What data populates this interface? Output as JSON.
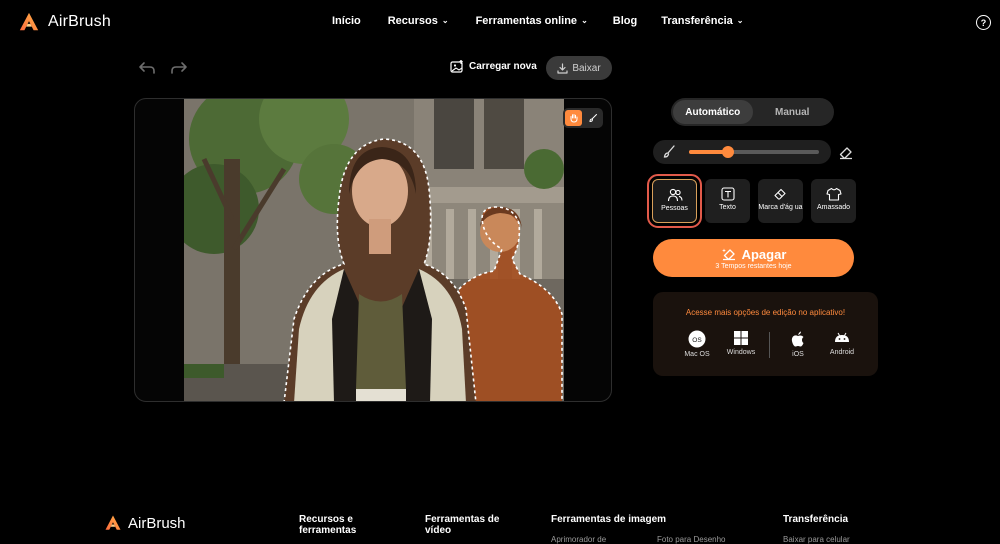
{
  "app": {
    "name": "AirBrush"
  },
  "nav": {
    "items": [
      {
        "label": "Início",
        "dropdown": false
      },
      {
        "label": "Recursos",
        "dropdown": true
      },
      {
        "label": "Ferramentas online",
        "dropdown": true
      },
      {
        "label": "Blog",
        "dropdown": false
      },
      {
        "label": "Transferência",
        "dropdown": true
      }
    ],
    "help_icon": "?"
  },
  "toolbar": {
    "upload_label": "Carregar nova",
    "download_label": "Baixar"
  },
  "panel": {
    "modes": [
      "Automático",
      "Manual"
    ],
    "active_mode": "Automático",
    "brush_size_fraction": 0.3,
    "tools": [
      {
        "label": "Pessoas",
        "icon": "people-icon",
        "selected": true
      },
      {
        "label": "Texto",
        "icon": "text-icon",
        "selected": false
      },
      {
        "label": "Marca d'ág ua",
        "icon": "watermark-eraser-icon",
        "selected": false
      },
      {
        "label": "Amassado",
        "icon": "shirt-icon",
        "selected": false
      }
    ],
    "erase_button": "Apagar",
    "remaining_text": "3 Tempos restantes hoje",
    "promo_title": "Acesse mais opções de edição no aplicativo!",
    "platforms": [
      {
        "label": "Mac OS",
        "icon": "macos-icon"
      },
      {
        "label": "Windows",
        "icon": "windows-icon"
      },
      {
        "label": "iOS",
        "icon": "apple-icon"
      },
      {
        "label": "Android",
        "icon": "android-icon"
      }
    ]
  },
  "footer": {
    "logo": "AirBrush",
    "columns": [
      {
        "title": "Recursos e ferramentas",
        "link": ""
      },
      {
        "title": "Ferramentas de vídeo",
        "link": ""
      },
      {
        "title": "Ferramentas de imagem",
        "link": "Aprimorador de",
        "link2": "Foto para Desenho"
      },
      {
        "title": "Transferência",
        "link": "Baixar para celular"
      }
    ]
  },
  "colors": {
    "accent": "#ff8a3d",
    "background": "#000000",
    "selection_outline": "#e25a4a"
  }
}
